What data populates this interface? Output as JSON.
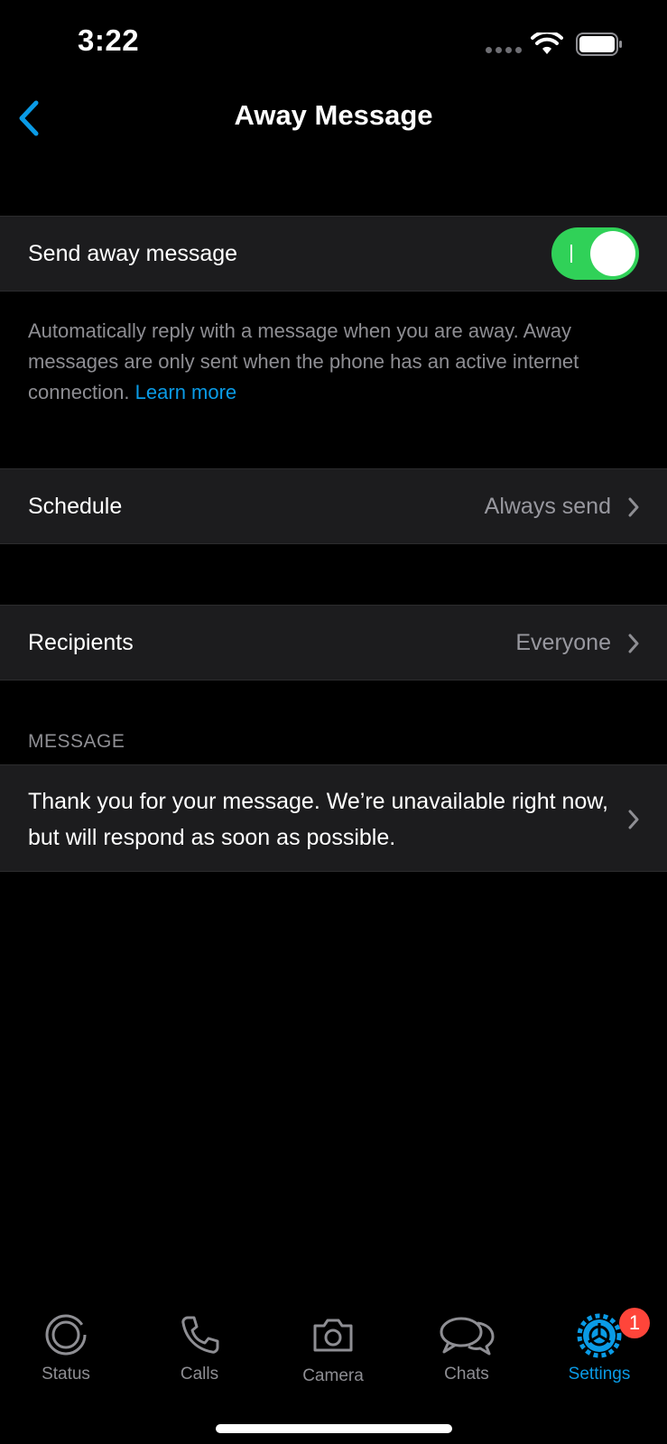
{
  "status_bar": {
    "time": "3:22"
  },
  "nav": {
    "title": "Away Message"
  },
  "send_away": {
    "label": "Send away message",
    "enabled": true
  },
  "description": {
    "text": "Automatically reply with a message when you are away. Away messages are only sent when the phone has an active internet connection.",
    "link": "Learn more"
  },
  "schedule": {
    "label": "Schedule",
    "value": "Always send"
  },
  "recipients": {
    "label": "Recipients",
    "value": "Everyone"
  },
  "message_section": {
    "header": "MESSAGE",
    "text": "Thank you for your message. We’re unavailable right now, but will respond as soon as possible."
  },
  "tabs": [
    {
      "label": "Status",
      "icon": "status-icon"
    },
    {
      "label": "Calls",
      "icon": "phone-icon"
    },
    {
      "label": "Camera",
      "icon": "camera-icon"
    },
    {
      "label": "Chats",
      "icon": "chats-icon"
    },
    {
      "label": "Settings",
      "icon": "settings-icon",
      "active": true,
      "badge": "1"
    }
  ],
  "colors": {
    "accent": "#0a9be6",
    "toggle_on": "#30d158",
    "badge": "#ff453a"
  }
}
